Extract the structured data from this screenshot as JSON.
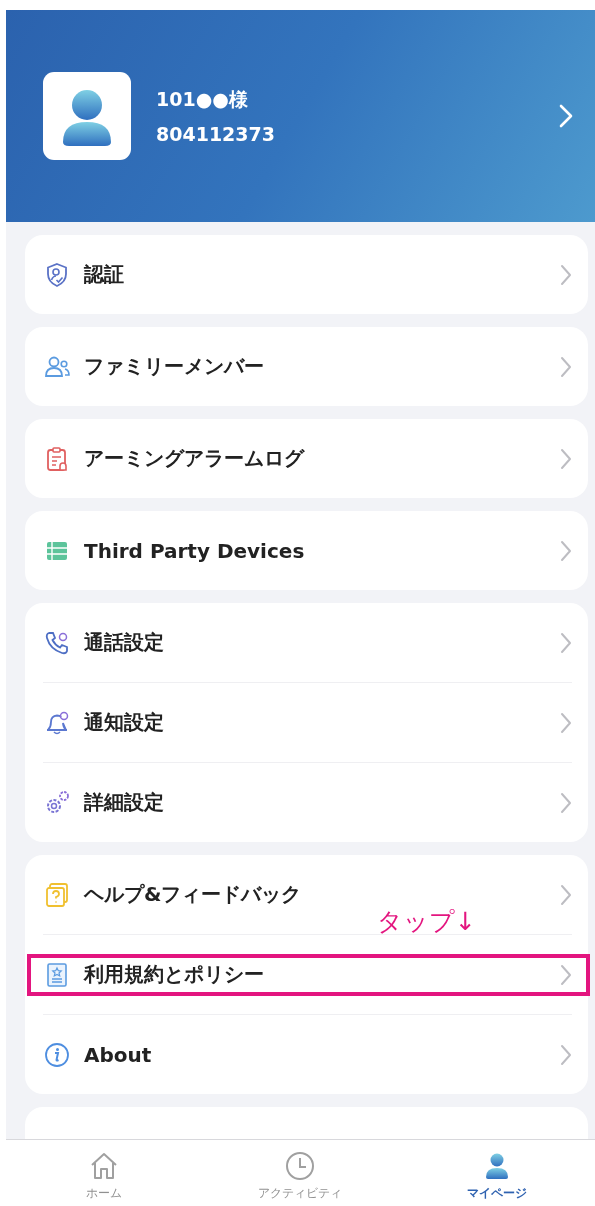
{
  "profile": {
    "name": "101●●様",
    "account_number": "804112373"
  },
  "menu_groups": [
    {
      "items": [
        {
          "label": "認証",
          "highlighted": false
        }
      ]
    },
    {
      "items": [
        {
          "label": "ファミリーメンバー",
          "highlighted": false
        }
      ]
    },
    {
      "items": [
        {
          "label": "アーミングアラームログ",
          "highlighted": false
        }
      ]
    },
    {
      "items": [
        {
          "label": "Third Party Devices",
          "highlighted": false
        }
      ]
    },
    {
      "items": [
        {
          "label": "通話設定",
          "highlighted": false
        },
        {
          "label": "通知設定",
          "highlighted": false
        },
        {
          "label": "詳細設定",
          "highlighted": false
        }
      ]
    },
    {
      "items": [
        {
          "label": "ヘルプ&フィードバック",
          "highlighted": false
        },
        {
          "label": "利用規約とポリシー",
          "highlighted": true
        },
        {
          "label": "About",
          "highlighted": false
        }
      ]
    }
  ],
  "annotation": {
    "text": "タップ↓"
  },
  "tabs": [
    {
      "label": "ホーム",
      "selected": false
    },
    {
      "label": "アクティビティ",
      "selected": false
    },
    {
      "label": "マイページ",
      "selected": true
    }
  ]
}
